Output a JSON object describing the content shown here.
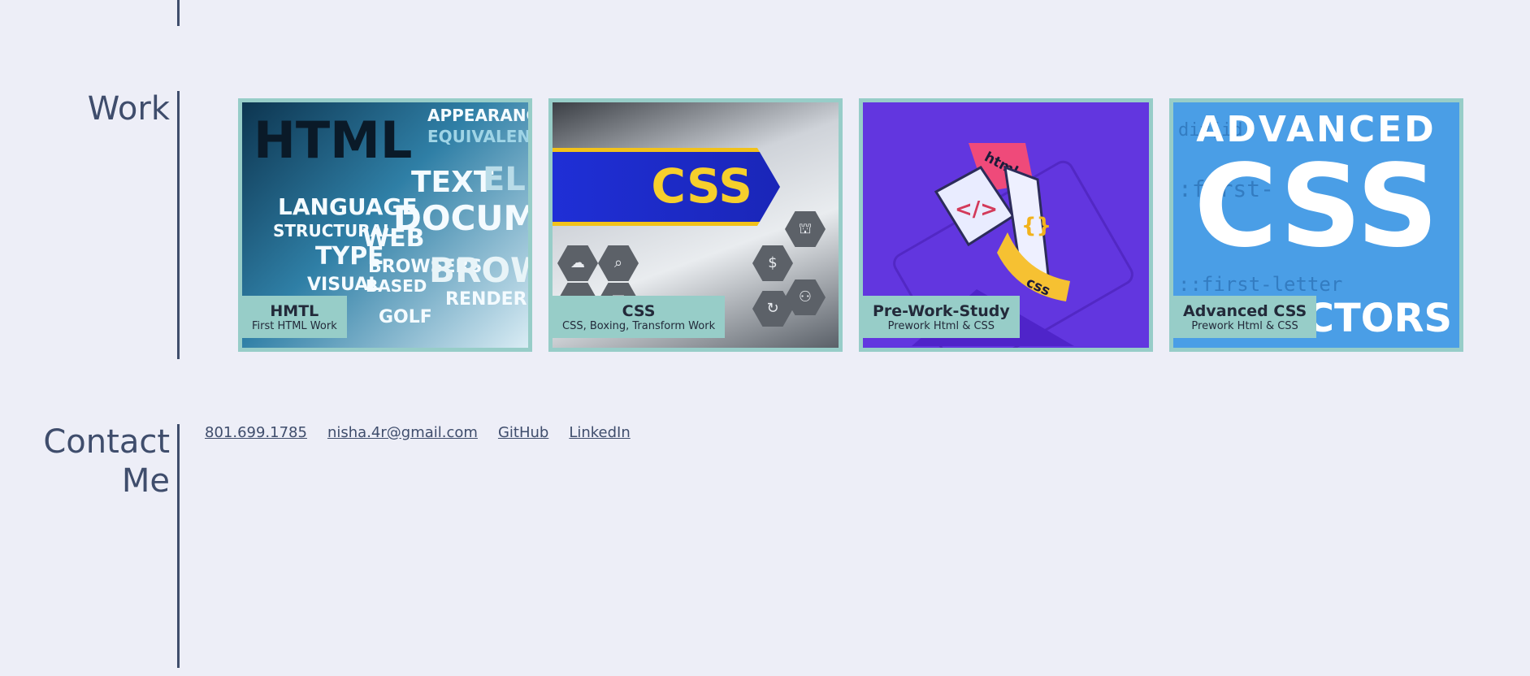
{
  "work": {
    "heading": "Work",
    "cards": [
      {
        "title": "HMTL",
        "subtitle": "First HTML Work",
        "image_icon": "html-wordcloud-image"
      },
      {
        "title": "CSS",
        "subtitle": "CSS, Boxing, Transform Work",
        "image_icon": "css-banner-image",
        "image_text": "CSS"
      },
      {
        "title": "Pre-Work-Study",
        "subtitle": "Prework Html & CSS",
        "image_icon": "html-css-files-image",
        "image_text_1": "html",
        "image_text_2": "css"
      },
      {
        "title": "Advanced CSS",
        "subtitle": "Prework Html & CSS",
        "image_icon": "advanced-css-selectors-image",
        "image_text_1": "ADVANCED",
        "image_text_2": "CSS",
        "image_text_3": "ECTORS"
      }
    ]
  },
  "contact": {
    "heading_line1": "Contact",
    "heading_line2": "Me",
    "links": [
      {
        "label": "801.699.1785"
      },
      {
        "label": "nisha.4r@gmail.com"
      },
      {
        "label": "GitHub"
      },
      {
        "label": "LinkedIn"
      }
    ]
  },
  "colors": {
    "background": "#edeef7",
    "text": "#3f4d6c",
    "card_border": "#97cdc8"
  }
}
